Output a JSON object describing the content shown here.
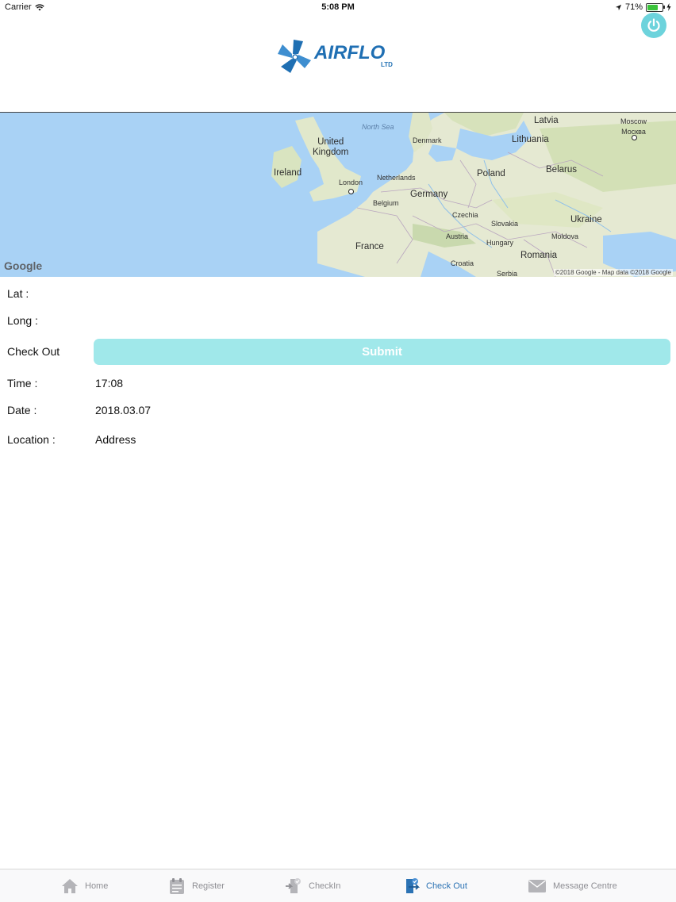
{
  "status_bar": {
    "carrier": "Carrier",
    "time": "5:08 PM",
    "battery_text": "71%",
    "battery_level": 0.71
  },
  "header": {
    "logo_text": "AIRFLO",
    "logo_sub": "LTD",
    "power_icon": "power-icon"
  },
  "map": {
    "labels": {
      "north_sea": "North Sea",
      "latvia": "Latvia",
      "moscow": "Moscow\nМосква",
      "denmark": "Denmark",
      "lithuania": "Lithuania",
      "united_kingdom": "United\nKingdom",
      "ireland": "Ireland",
      "netherlands": "Netherlands",
      "poland": "Poland",
      "belarus": "Belarus",
      "london": "London",
      "germany": "Germany",
      "belgium": "Belgium",
      "czechia": "Czechia",
      "ukraine": "Ukraine",
      "slovakia": "Slovakia",
      "austria": "Austria",
      "moldova": "Moldova",
      "hungary": "Hungary",
      "france": "France",
      "romania": "Romania",
      "croatia": "Croatia",
      "serbia": "Serbia"
    },
    "google_logo": "Google",
    "attribution": "©2018 Google - Map data ©2018 Google"
  },
  "form": {
    "lat_label": "Lat :",
    "lat_value": "",
    "long_label": "Long :",
    "long_value": "",
    "checkout_label": "Check Out",
    "submit_label": "Submit",
    "time_label": "Time :",
    "time_value": "17:08",
    "date_label": "Date :",
    "date_value": "2018.03.07",
    "location_label": "Location :",
    "location_value": "Address"
  },
  "tabbar": {
    "active_tab": "Check Out",
    "tabs": [
      {
        "label": "Home",
        "icon": "home-icon"
      },
      {
        "label": "Register",
        "icon": "register-icon"
      },
      {
        "label": "CheckIn",
        "icon": "checkin-icon"
      },
      {
        "label": "Check Out",
        "icon": "checkout-icon"
      },
      {
        "label": "Message Centre",
        "icon": "mail-icon"
      }
    ]
  },
  "colors": {
    "accent": "#6dd3dc",
    "submit_bg": "#a0e8ea",
    "tab_active": "#2c73b4",
    "tab_inactive": "#8e8e93",
    "logo_blue": "#1f6fb3"
  }
}
